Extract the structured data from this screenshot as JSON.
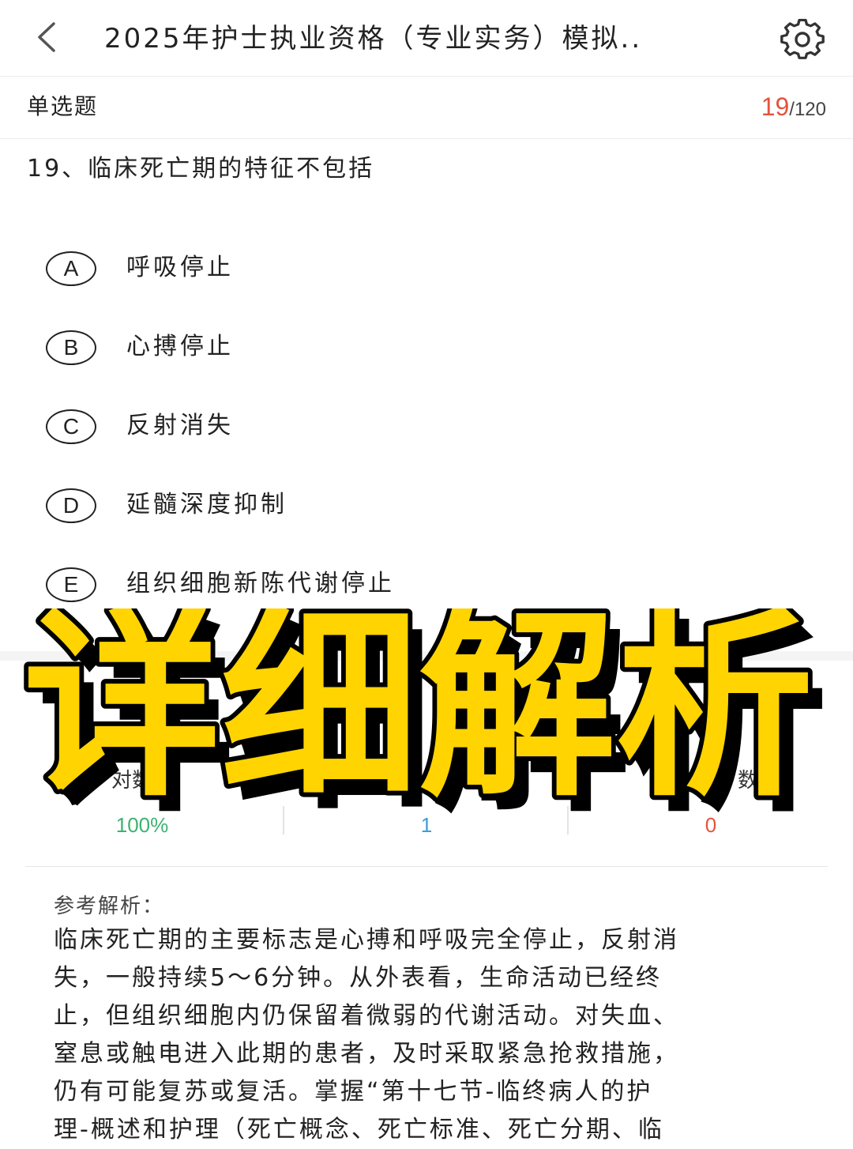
{
  "header": {
    "back_icon": "chevron-left-icon",
    "title": "2025年护士执业资格（专业实务）模拟..",
    "settings_icon": "gear-icon"
  },
  "question_meta": {
    "type": "单选题",
    "current": "19",
    "separator": "/",
    "total": "120"
  },
  "question": {
    "text": "19、临床死亡期的特征不包括",
    "options": [
      {
        "letter": "A",
        "text": "呼吸停止"
      },
      {
        "letter": "B",
        "text": "心搏停止"
      },
      {
        "letter": "C",
        "text": "反射消失"
      },
      {
        "letter": "D",
        "text": "延髓深度抑制"
      },
      {
        "letter": "E",
        "text": "组织细胞新陈代谢停止"
      }
    ]
  },
  "stats": {
    "col1_label": "对数率",
    "col1_value": "100%",
    "col2_value": "1",
    "col3_label": "数",
    "col3_value": "0"
  },
  "overlay": {
    "text": "详细解析",
    "color": "#FFD400",
    "shadow": "#000000"
  },
  "explanation": {
    "heading": "参考解析：",
    "lines": [
      "临床死亡期的主要标志是心搏和呼吸完全停止，反射消",
      "失，一般持续5～6分钟。从外表看，生命活动已经终",
      "止，但组织细胞内仍保留着微弱的代谢活动。对失血、",
      "窒息或触电进入此期的患者，及时采取紧急抢救措施，",
      "仍有可能复苏或复活。掌握“第十七节-临终病人的护",
      "理-概述和护理（死亡概念、死亡标准、死亡分期、临"
    ]
  }
}
